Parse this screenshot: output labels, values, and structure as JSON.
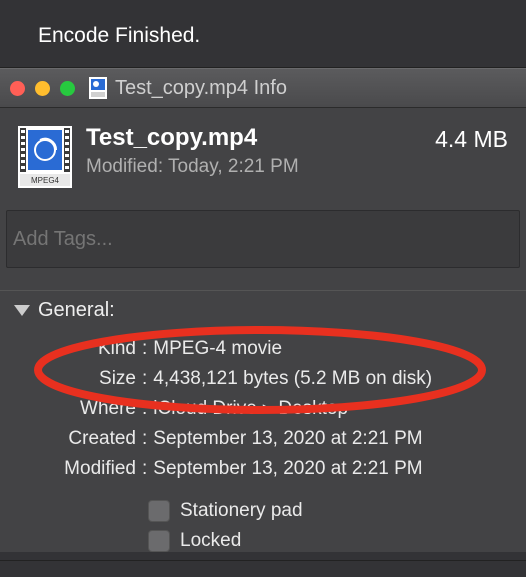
{
  "status_message": "Encode Finished.",
  "window": {
    "title": "Test_copy.mp4 Info",
    "filename": "Test_copy.mp4",
    "size_short": "4.4 MB",
    "modified_short_label": "Modified:",
    "modified_short_value": "Today, 2:21 PM",
    "tags_placeholder": "Add Tags...",
    "file_icon_badge": "MPEG4"
  },
  "general": {
    "section_title": "General:",
    "rows": {
      "kind": {
        "label": "Kind",
        "value": "MPEG-4 movie"
      },
      "size": {
        "label": "Size",
        "value": "4,438,121 bytes (5.2 MB on disk)"
      },
      "where": {
        "label": "Where",
        "path": [
          "iCloud Drive",
          "Desktop"
        ]
      },
      "created": {
        "label": "Created",
        "value": "September 13, 2020 at 2:21 PM"
      },
      "modified": {
        "label": "Modified",
        "value": "September 13, 2020 at 2:21 PM"
      }
    },
    "checkboxes": {
      "stationery": {
        "label": "Stationery pad",
        "checked": false
      },
      "locked": {
        "label": "Locked",
        "checked": false
      }
    }
  },
  "annotation": {
    "color": "#e8301f"
  }
}
